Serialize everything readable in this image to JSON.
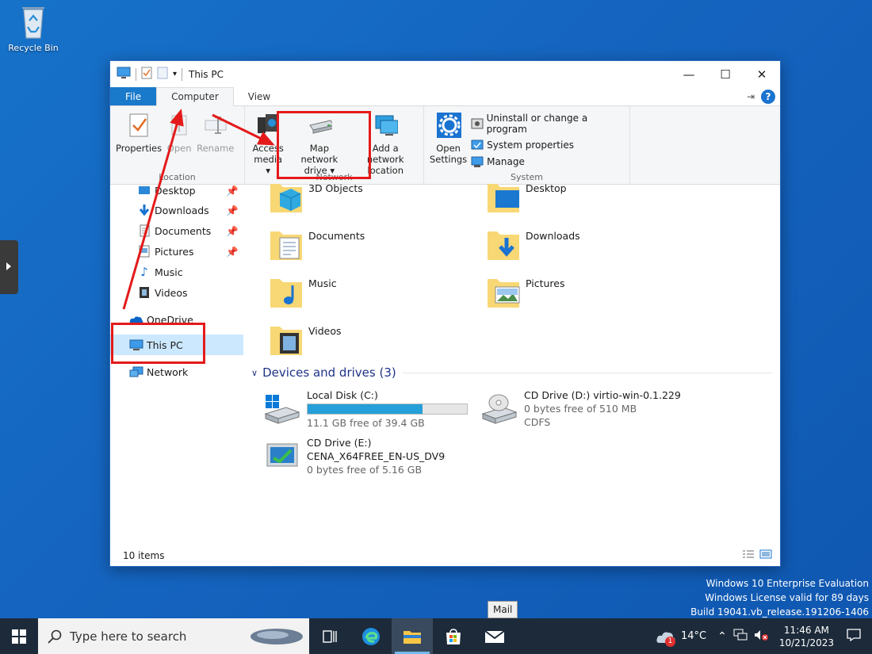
{
  "desktop": {
    "recycle_bin_label": "Recycle Bin",
    "watermark": {
      "line1": "Windows 10 Enterprise Evaluation",
      "line2": "Windows License valid for 89 days",
      "line3": "Build 19041.vb_release.191206-1406"
    }
  },
  "window": {
    "title": "This PC",
    "controls": {
      "minimize": "—",
      "maximize": "☐",
      "close": "✕"
    }
  },
  "ribbon": {
    "tabs": {
      "file": "File",
      "computer": "Computer",
      "view": "View"
    },
    "location": {
      "label": "Location",
      "properties": "Properties",
      "open": "Open",
      "rename": "Rename"
    },
    "network": {
      "label": "Network",
      "access_media": "Access media",
      "access_media_l1": "Access",
      "access_media_l2": "media",
      "map_drive_l1": "Map network",
      "map_drive_l2": "drive",
      "add_location_l1": "Add a network",
      "add_location_l2": "location"
    },
    "system": {
      "label": "System",
      "open_settings_l1": "Open",
      "open_settings_l2": "Settings",
      "uninstall": "Uninstall or change a program",
      "system_properties": "System properties",
      "manage": "Manage"
    }
  },
  "nav": {
    "items": [
      {
        "label": "Desktop",
        "pinned": true
      },
      {
        "label": "Downloads",
        "pinned": true
      },
      {
        "label": "Documents",
        "pinned": true
      },
      {
        "label": "Pictures",
        "pinned": true
      },
      {
        "label": "Music",
        "pinned": false
      },
      {
        "label": "Videos",
        "pinned": false
      },
      {
        "label": "OneDrive",
        "pinned": false
      },
      {
        "label": "This PC",
        "pinned": false,
        "selected": true
      },
      {
        "label": "Network",
        "pinned": false
      }
    ]
  },
  "folders": [
    {
      "name": "3D Objects"
    },
    {
      "name": "Desktop"
    },
    {
      "name": "Documents"
    },
    {
      "name": "Downloads"
    },
    {
      "name": "Music"
    },
    {
      "name": "Pictures"
    },
    {
      "name": "Videos"
    }
  ],
  "devices": {
    "heading": "Devices and drives (3)",
    "drives": [
      {
        "name": "Local Disk (C:)",
        "free": "11.1 GB free of 39.4 GB",
        "used_fraction": 0.72
      },
      {
        "name": "CD Drive (D:) virtio-win-0.1.229",
        "free": "0 bytes free of 510 MB",
        "fs": "CDFS"
      },
      {
        "name": "CD Drive (E:)",
        "label": "CENA_X64FREE_EN-US_DV9",
        "free": "0 bytes free of 5.16 GB"
      }
    ]
  },
  "status": {
    "item_count": "10 items"
  },
  "taskbar": {
    "search_placeholder": "Type here to search",
    "tooltip": "Mail",
    "weather": "14°C",
    "weather_badge": "1",
    "time": "11:46 AM",
    "date": "10/21/2023"
  },
  "colors": {
    "accent": "#1979ca",
    "annotation": "#e41a1a",
    "drive_bar": "#26a0da",
    "selection": "#cce8ff"
  }
}
